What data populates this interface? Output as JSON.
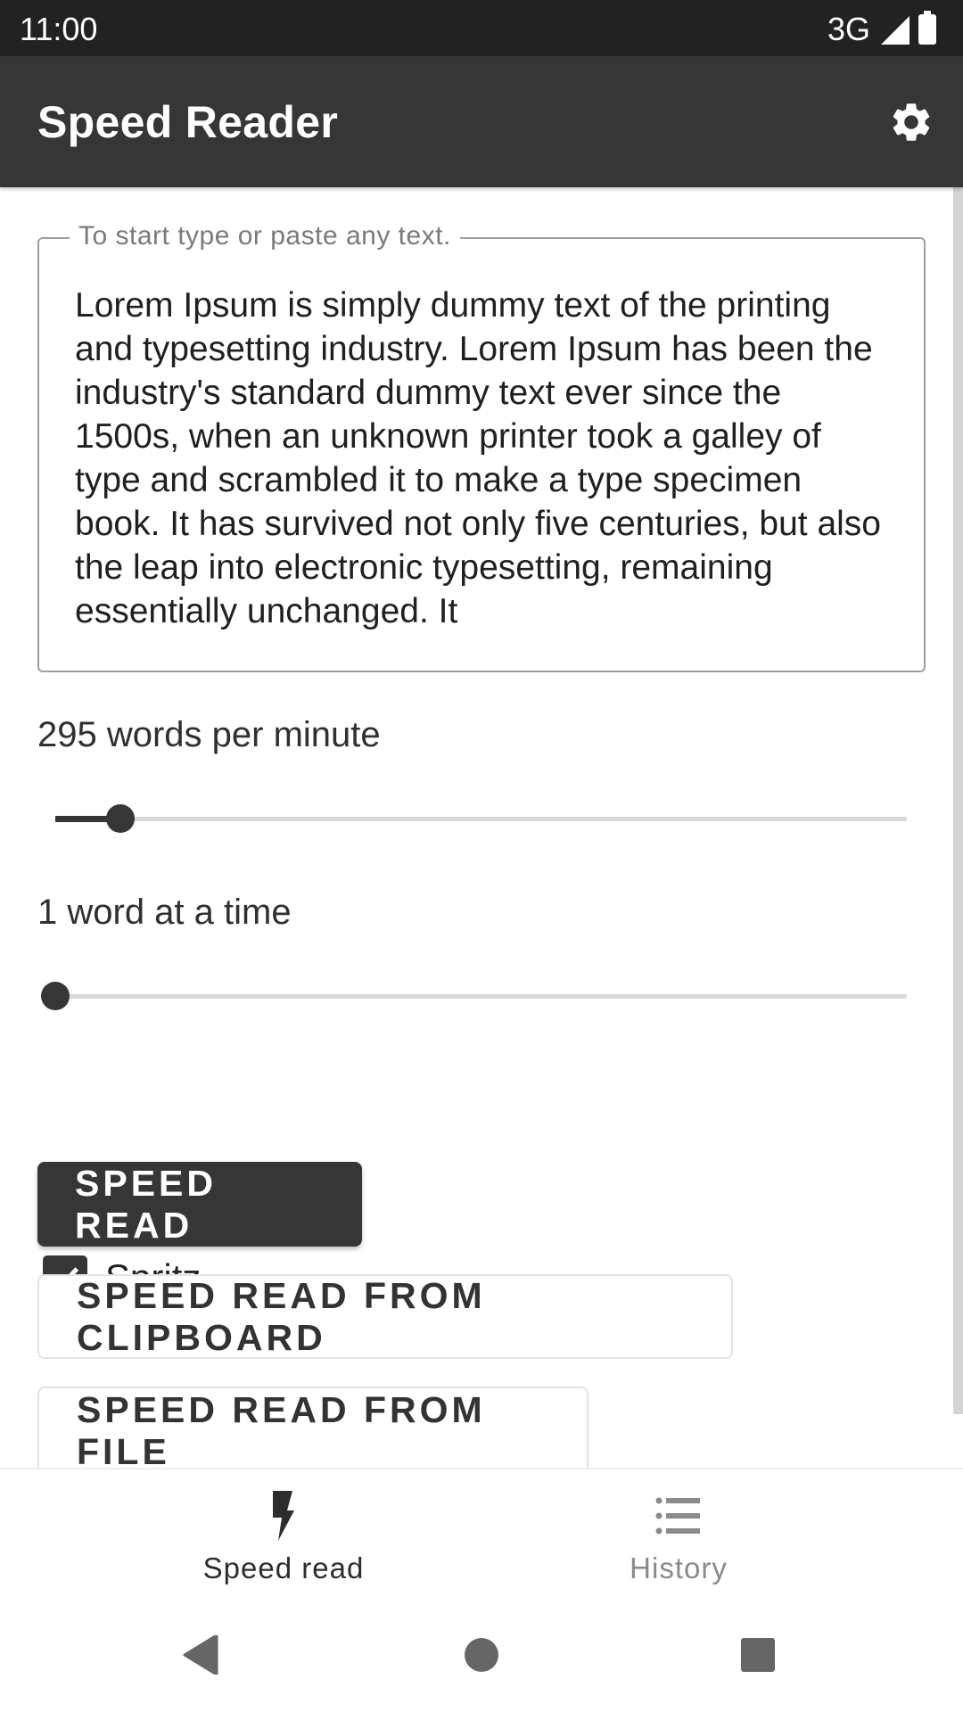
{
  "status_bar": {
    "time": "11:00",
    "network": "3G",
    "icons": [
      "signal-icon",
      "battery-icon"
    ]
  },
  "app_bar": {
    "title": "Speed Reader",
    "settings_icon": "gear-icon"
  },
  "text_input": {
    "label": "To start type or paste any text.",
    "value": "Lorem Ipsum is simply dummy text of the printing and typesetting industry. Lorem Ipsum has been the industry's standard dummy text ever since the 1500s, when an unknown printer took a galley of type and scrambled it to make a type specimen book. It has survived not only five centuries, but also the leap into electronic typesetting, remaining essentially unchanged. It"
  },
  "wpm": {
    "label": "295 words per minute",
    "value": 295,
    "slider_fraction": 0.076
  },
  "chunk": {
    "label": "1 word at a time",
    "value": 1,
    "slider_fraction": 0.0
  },
  "spritz": {
    "label": "Spritz",
    "checked": true
  },
  "buttons": {
    "speed_read": "SPEED READ",
    "from_clipboard": "SPEED READ FROM CLIPBOARD",
    "from_file": "SPEED READ FROM FILE"
  },
  "bottom_nav": {
    "items": [
      {
        "label": "Speed read",
        "icon": "lightning-bolt-icon",
        "active": true
      },
      {
        "label": "History",
        "icon": "list-icon",
        "active": false
      }
    ]
  },
  "system_nav": {
    "icons": [
      "back-icon",
      "home-icon",
      "recents-icon"
    ]
  },
  "colors": {
    "primary": "#363636",
    "status_bar": "#222222",
    "slider_track": "#d9d9d9"
  }
}
